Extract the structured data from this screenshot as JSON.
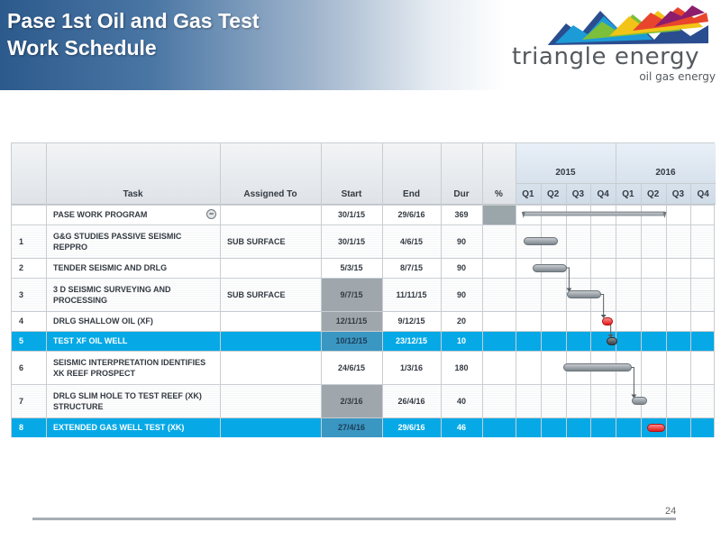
{
  "slide": {
    "title_line1": "Pase 1st Oil and Gas Test",
    "title_line2": "Work  Schedule",
    "page_number": "24"
  },
  "logo": {
    "name": "triangle energy",
    "tagline": "oil gas energy",
    "colors": [
      "#2a4d8f",
      "#1d9bd7",
      "#7bbf3a",
      "#f2c418",
      "#e8452c",
      "#8c1d6d"
    ]
  },
  "table": {
    "columns": {
      "task": "Task",
      "assigned": "Assigned To",
      "start": "Start",
      "end": "End",
      "dur": "Dur",
      "pct": "%"
    },
    "years": [
      "2015",
      "2016"
    ],
    "quarters": [
      "Q1",
      "Q2",
      "Q3",
      "Q4",
      "Q1",
      "Q2",
      "Q3",
      "Q4"
    ],
    "rows": [
      {
        "num": "",
        "task": "PASE WORK PROGRAM",
        "assigned": "",
        "start": "30/1/15",
        "end": "29/6/16",
        "dur": "369",
        "summary": true
      },
      {
        "num": "1",
        "task": "G&G STUDIES PASSIVE SEISMIC REPPRO",
        "assigned": "SUB SURFACE",
        "start": "30/1/15",
        "end": "4/6/15",
        "dur": "90"
      },
      {
        "num": "2",
        "task": "TENDER SEISMIC AND DRLG",
        "assigned": "",
        "start": "5/3/15",
        "end": "8/7/15",
        "dur": "90"
      },
      {
        "num": "3",
        "task": "3 D SEISMIC SURVEYING AND PROCESSING",
        "assigned": "SUB SURFACE",
        "start": "9/7/15",
        "end": "11/11/15",
        "dur": "90"
      },
      {
        "num": "4",
        "task": "DRLG SHALLOW OIL (XF)",
        "assigned": "",
        "start": "12/11/15",
        "end": "9/12/15",
        "dur": "20"
      },
      {
        "num": "5",
        "task": "TEST XF OIL WELL",
        "assigned": "",
        "start": "10/12/15",
        "end": "23/12/15",
        "dur": "10",
        "highlight": true
      },
      {
        "num": "6",
        "task": "SEISMIC INTERPRETATION IDENTIFIES XK REEF PROSPECT",
        "assigned": "",
        "start": "24/6/15",
        "end": "1/3/16",
        "dur": "180"
      },
      {
        "num": "7",
        "task": "DRLG SLIM HOLE TO TEST REEF (XK)  STRUCTURE",
        "assigned": "",
        "start": "2/3/16",
        "end": "26/4/16",
        "dur": "40"
      },
      {
        "num": "8",
        "task": "EXTENDED GAS WELL TEST (XK)",
        "assigned": "",
        "start": "27/4/16",
        "end": "29/6/16",
        "dur": "46",
        "highlight": true
      }
    ]
  },
  "chart_data": {
    "type": "gantt",
    "timeline": [
      "2015 Q1",
      "2015 Q2",
      "2015 Q3",
      "2015 Q4",
      "2016 Q1",
      "2016 Q2",
      "2016 Q3",
      "2016 Q4"
    ],
    "tasks": [
      {
        "task": "PASE WORK PROGRAM",
        "start": "30/1/15",
        "end": "29/6/16",
        "style": "summary"
      },
      {
        "task": "G&G STUDIES PASSIVE SEISMIC REPPRO",
        "start": "30/1/15",
        "end": "4/6/15",
        "style": "gray"
      },
      {
        "task": "TENDER SEISMIC AND DRLG",
        "start": "5/3/15",
        "end": "8/7/15",
        "style": "gray"
      },
      {
        "task": "3 D SEISMIC SURVEYING AND PROCESSING",
        "start": "9/7/15",
        "end": "11/11/15",
        "style": "gray"
      },
      {
        "task": "DRLG SHALLOW OIL (XF)",
        "start": "12/11/15",
        "end": "9/12/15",
        "style": "red"
      },
      {
        "task": "TEST XF OIL WELL",
        "start": "10/12/15",
        "end": "23/12/15",
        "style": "dark"
      },
      {
        "task": "SEISMIC INTERPRETATION IDENTIFIES XK REEF PROSPECT",
        "start": "24/6/15",
        "end": "1/3/16",
        "style": "gray"
      },
      {
        "task": "DRLG SLIM HOLE TO TEST REEF (XK)  STRUCTURE",
        "start": "2/3/16",
        "end": "26/4/16",
        "style": "gray"
      },
      {
        "task": "EXTENDED GAS WELL TEST (XK)",
        "start": "27/4/16",
        "end": "29/6/16",
        "style": "red"
      }
    ],
    "dependencies": [
      [
        2,
        3
      ],
      [
        3,
        4
      ],
      [
        4,
        5
      ],
      [
        6,
        7
      ]
    ],
    "colors": {
      "highlight_row": "#06a9e6",
      "bar_gray": "#8a9298",
      "bar_red": "#e01a1a",
      "shaded_cell": "#9fa7ad"
    }
  }
}
